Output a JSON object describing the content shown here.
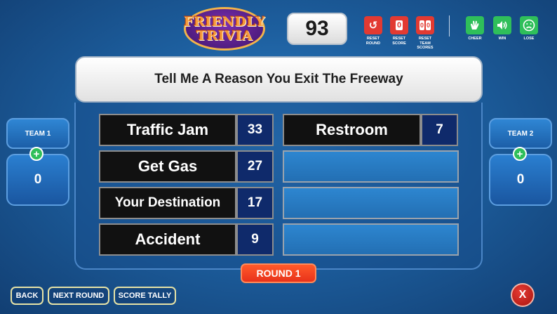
{
  "logo": {
    "line1": "FRIENDLY",
    "line2": "TRIVIA"
  },
  "score_display": "93",
  "controls": {
    "reset_round": {
      "glyph": "↺",
      "label": "RESET ROUND"
    },
    "reset_score": {
      "glyph": "0",
      "label": "RESET SCORE"
    },
    "reset_team_scores": {
      "glyph_a": "0",
      "glyph_b": "0",
      "label": "RESET TEAM SCORES"
    },
    "cheer": {
      "icon": "hands-clap-icon",
      "label": "CHEER"
    },
    "win": {
      "icon": "speaker-icon",
      "label": "WIN"
    },
    "lose": {
      "icon": "sad-face-icon",
      "label": "LOSE"
    }
  },
  "question": "Tell Me A Reason You Exit The Freeway",
  "answers": [
    {
      "text": "Traffic Jam",
      "points": "33"
    },
    {
      "text": "Get Gas",
      "points": "27"
    },
    {
      "text": "Your Destination",
      "points": "17"
    },
    {
      "text": "Accident",
      "points": "9"
    },
    {
      "text": "Restroom",
      "points": "7"
    }
  ],
  "teams": [
    {
      "name": "TEAM 1",
      "score": "0",
      "add_glyph": "+"
    },
    {
      "name": "TEAM 2",
      "score": "0",
      "add_glyph": "+"
    }
  ],
  "round_label": "ROUND 1",
  "bottom": {
    "back": "BACK",
    "next_round": "NEXT ROUND",
    "score_tally": "SCORE TALLY",
    "close_glyph": "X"
  },
  "colors": {
    "accent_red": "#e23a32",
    "accent_green": "#2fbf5a",
    "round_orange": "#ff5a2a",
    "answer_points_bg": "#0f2a6b"
  }
}
